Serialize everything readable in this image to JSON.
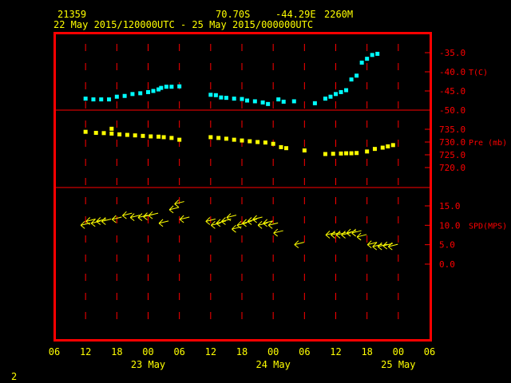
{
  "header": {
    "station": "21359",
    "lat": "70.70S",
    "lon": "-44.29E",
    "elev": "2260M",
    "period": "22 May 2015/120000UTC - 25 May 2015/000000UTC"
  },
  "corner_label": "2",
  "colors": {
    "frame": "#ff0000",
    "grid": "#ff0000",
    "text": "#ffff00",
    "temp": "#00ffff",
    "pressure": "#ffff00",
    "wind": "#ffff00"
  },
  "chart_data": {
    "type": "scatter",
    "x_unit": "hours since 22 May 2015 06 UTC",
    "xlim": [
      0,
      72
    ],
    "x_ticks": [
      {
        "x": 0,
        "label": "06"
      },
      {
        "x": 6,
        "label": "12"
      },
      {
        "x": 12,
        "label": "18"
      },
      {
        "x": 18,
        "label": "00"
      },
      {
        "x": 24,
        "label": "06"
      },
      {
        "x": 30,
        "label": "12"
      },
      {
        "x": 36,
        "label": "18"
      },
      {
        "x": 42,
        "label": "00"
      },
      {
        "x": 48,
        "label": "06"
      },
      {
        "x": 54,
        "label": "12"
      },
      {
        "x": 60,
        "label": "18"
      },
      {
        "x": 66,
        "label": "00"
      },
      {
        "x": 72,
        "label": "06"
      }
    ],
    "date_labels": [
      {
        "x": 18,
        "label": "23 May"
      },
      {
        "x": 42,
        "label": "24 May"
      },
      {
        "x": 66,
        "label": "25 May"
      }
    ],
    "panels": [
      {
        "name": "temperature",
        "ylabel": "T(C)",
        "ylim": [
          -50,
          -35
        ],
        "ticks": [
          -35.0,
          -40.0,
          -45.0,
          -50.0
        ],
        "tick_labels": [
          "-35.0",
          "-40.0",
          "-45.0",
          "-50.0"
        ],
        "points": [
          [
            6,
            -47
          ],
          [
            7.5,
            -47.2
          ],
          [
            9,
            -47.2
          ],
          [
            10.5,
            -47.2
          ],
          [
            12,
            -46.5
          ],
          [
            13.5,
            -46.3
          ],
          [
            15,
            -45.8
          ],
          [
            16.5,
            -45.6
          ],
          [
            18,
            -45.3
          ],
          [
            19,
            -45
          ],
          [
            20,
            -44.6
          ],
          [
            20.5,
            -44.2
          ],
          [
            21.5,
            -43.9
          ],
          [
            22.5,
            -43.9
          ],
          [
            24,
            -43.8
          ],
          [
            30,
            -46
          ],
          [
            31,
            -46.1
          ],
          [
            32,
            -46.7
          ],
          [
            33,
            -46.8
          ],
          [
            34.5,
            -47
          ],
          [
            36,
            -47.1
          ],
          [
            37,
            -47.5
          ],
          [
            38.5,
            -47.7
          ],
          [
            40,
            -48
          ],
          [
            41,
            -48.4
          ],
          [
            43,
            -47.2
          ],
          [
            44,
            -47.8
          ],
          [
            46,
            -47.7
          ],
          [
            50,
            -48.2
          ],
          [
            52,
            -47
          ],
          [
            53,
            -46.5
          ],
          [
            54,
            -45.8
          ],
          [
            55,
            -45.3
          ],
          [
            56,
            -44.8
          ],
          [
            57,
            -42
          ],
          [
            58,
            -41
          ],
          [
            59,
            -37.6
          ],
          [
            60,
            -36.6
          ],
          [
            61,
            -35.6
          ],
          [
            62,
            -35.3
          ]
        ]
      },
      {
        "name": "pressure",
        "ylabel": "Pre (mb)",
        "ylim": [
          720,
          735
        ],
        "ticks": [
          735.0,
          730.0,
          725.0,
          720.0
        ],
        "tick_labels": [
          "735.0",
          "730.0",
          "725.0",
          "720.0"
        ],
        "points": [
          [
            6,
            734
          ],
          [
            8,
            733.6
          ],
          [
            9.5,
            733.5
          ],
          [
            11,
            733.3
          ],
          [
            12.5,
            733
          ],
          [
            14,
            732.8
          ],
          [
            15.5,
            732.6
          ],
          [
            17,
            732.4
          ],
          [
            18.5,
            732.2
          ],
          [
            20,
            732.1
          ],
          [
            21,
            731.9
          ],
          [
            22.5,
            731.6
          ],
          [
            24,
            730.9
          ],
          [
            11,
            735.2
          ],
          [
            30,
            731.9
          ],
          [
            31.5,
            731.6
          ],
          [
            33,
            731.3
          ],
          [
            34.5,
            730.9
          ],
          [
            36,
            730.6
          ],
          [
            37.5,
            730.3
          ],
          [
            39,
            730
          ],
          [
            40.5,
            729.8
          ],
          [
            42,
            729.3
          ],
          [
            43.5,
            728
          ],
          [
            44.5,
            727.6
          ],
          [
            48,
            726.7
          ],
          [
            52,
            725.3
          ],
          [
            53.5,
            725.4
          ],
          [
            55,
            725.5
          ],
          [
            56,
            725.6
          ],
          [
            57,
            725.6
          ],
          [
            58,
            725.7
          ],
          [
            60,
            726.3
          ],
          [
            61.5,
            727.3
          ],
          [
            63,
            727.8
          ],
          [
            64,
            728.3
          ],
          [
            65,
            728.8
          ]
        ]
      },
      {
        "name": "wind",
        "ylabel": "SPD(MPS)",
        "ylim": [
          0,
          15
        ],
        "ticks": [
          15.0,
          10.0,
          5.0,
          0.0
        ],
        "tick_labels": [
          "15.0",
          "10.0",
          "5.0",
          "0.0"
        ],
        "points": [
          [
            6,
            10
          ],
          [
            7,
            11
          ],
          [
            8,
            10.5
          ],
          [
            9,
            11
          ],
          [
            10,
            11
          ],
          [
            12,
            11.5
          ],
          [
            14,
            12.5
          ],
          [
            15.5,
            12
          ],
          [
            17,
            12
          ],
          [
            18,
            12.2
          ],
          [
            19,
            12.5
          ],
          [
            21,
            10.5
          ],
          [
            23,
            14
          ],
          [
            24,
            15.5
          ],
          [
            25,
            11.5
          ],
          [
            30,
            11
          ],
          [
            31,
            10
          ],
          [
            32,
            10.5
          ],
          [
            33,
            11
          ],
          [
            34,
            12
          ],
          [
            35,
            9
          ],
          [
            36,
            10
          ],
          [
            37,
            10.5
          ],
          [
            38,
            11
          ],
          [
            39,
            11.5
          ],
          [
            40,
            10
          ],
          [
            41,
            10.5
          ],
          [
            42,
            10
          ],
          [
            43,
            8
          ],
          [
            47,
            5
          ],
          [
            53,
            7.5
          ],
          [
            54,
            7.5
          ],
          [
            55,
            7.5
          ],
          [
            56,
            7.5
          ],
          [
            57,
            8
          ],
          [
            58,
            8
          ],
          [
            59,
            7
          ],
          [
            61,
            5
          ],
          [
            62,
            4.5
          ],
          [
            63,
            4.5
          ],
          [
            64,
            4.7
          ],
          [
            65,
            4.5
          ]
        ]
      }
    ]
  }
}
